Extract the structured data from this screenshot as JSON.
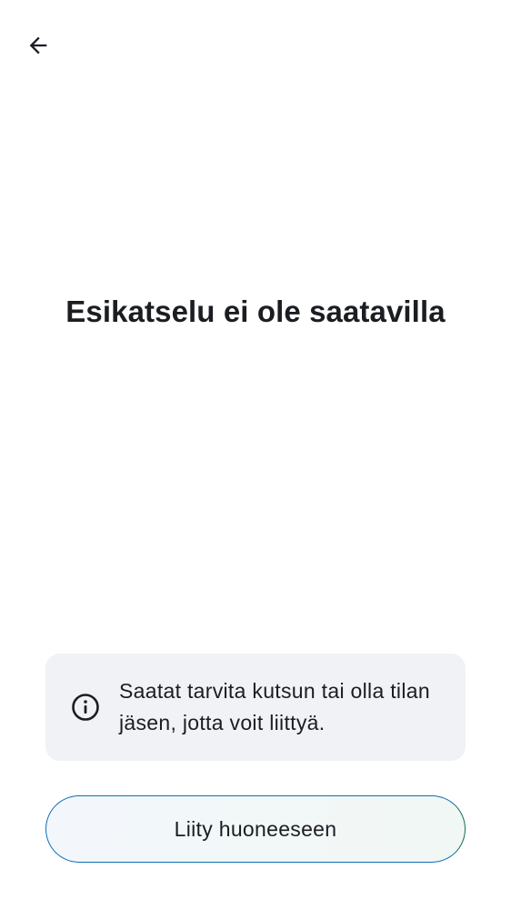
{
  "header": {
    "back_icon": "arrow-left-icon"
  },
  "main": {
    "title": "Esikatselu ei ole saatavilla"
  },
  "info_card": {
    "icon": "info-icon",
    "text": "Saatat tarvita kutsun tai olla tilan jäsen, jotta voit liittyä."
  },
  "actions": {
    "join_label": "Liity huoneeseen"
  },
  "colors": {
    "background": "#ffffff",
    "text": "#1b1d22",
    "card_background": "#f0f2f5",
    "button_border_start": "#0b6fb8",
    "button_border_end": "#0f6e55"
  }
}
